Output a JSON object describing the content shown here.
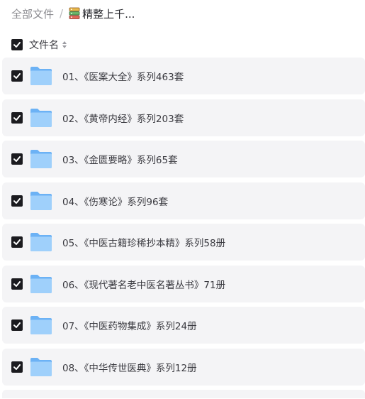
{
  "breadcrumb": {
    "root": "全部文件",
    "separator": "/",
    "current_icon": "book-stack-icon",
    "current": "精整上千..."
  },
  "header": {
    "select_all_checked": true,
    "column_label": "文件名",
    "sort_icon": "sort-icon"
  },
  "files": [
    {
      "name": "01、《医案大全》系列463套",
      "checked": true,
      "icon": "folder-icon"
    },
    {
      "name": "02、《黄帝内经》系列203套",
      "checked": true,
      "icon": "folder-icon"
    },
    {
      "name": "03、《金匮要略》系列65套",
      "checked": true,
      "icon": "folder-icon"
    },
    {
      "name": "04、《伤寒论》系列96套",
      "checked": true,
      "icon": "folder-icon"
    },
    {
      "name": "05、《中医古籍珍稀抄本精》系列58册",
      "checked": true,
      "icon": "folder-icon"
    },
    {
      "name": "06、《现代著名老中医名著丛书》71册",
      "checked": true,
      "icon": "folder-icon"
    },
    {
      "name": "07、《中医药物集成》系列24册",
      "checked": true,
      "icon": "folder-icon"
    },
    {
      "name": "08、《中华传世医典》系列12册",
      "checked": true,
      "icon": "folder-icon"
    }
  ],
  "colors": {
    "row_bg": "#f4f4f6",
    "checkbox": "#1b1b1f",
    "folder_light": "#9fd0fb",
    "folder_dark": "#6cb2f5",
    "text": "#3a3a40"
  }
}
